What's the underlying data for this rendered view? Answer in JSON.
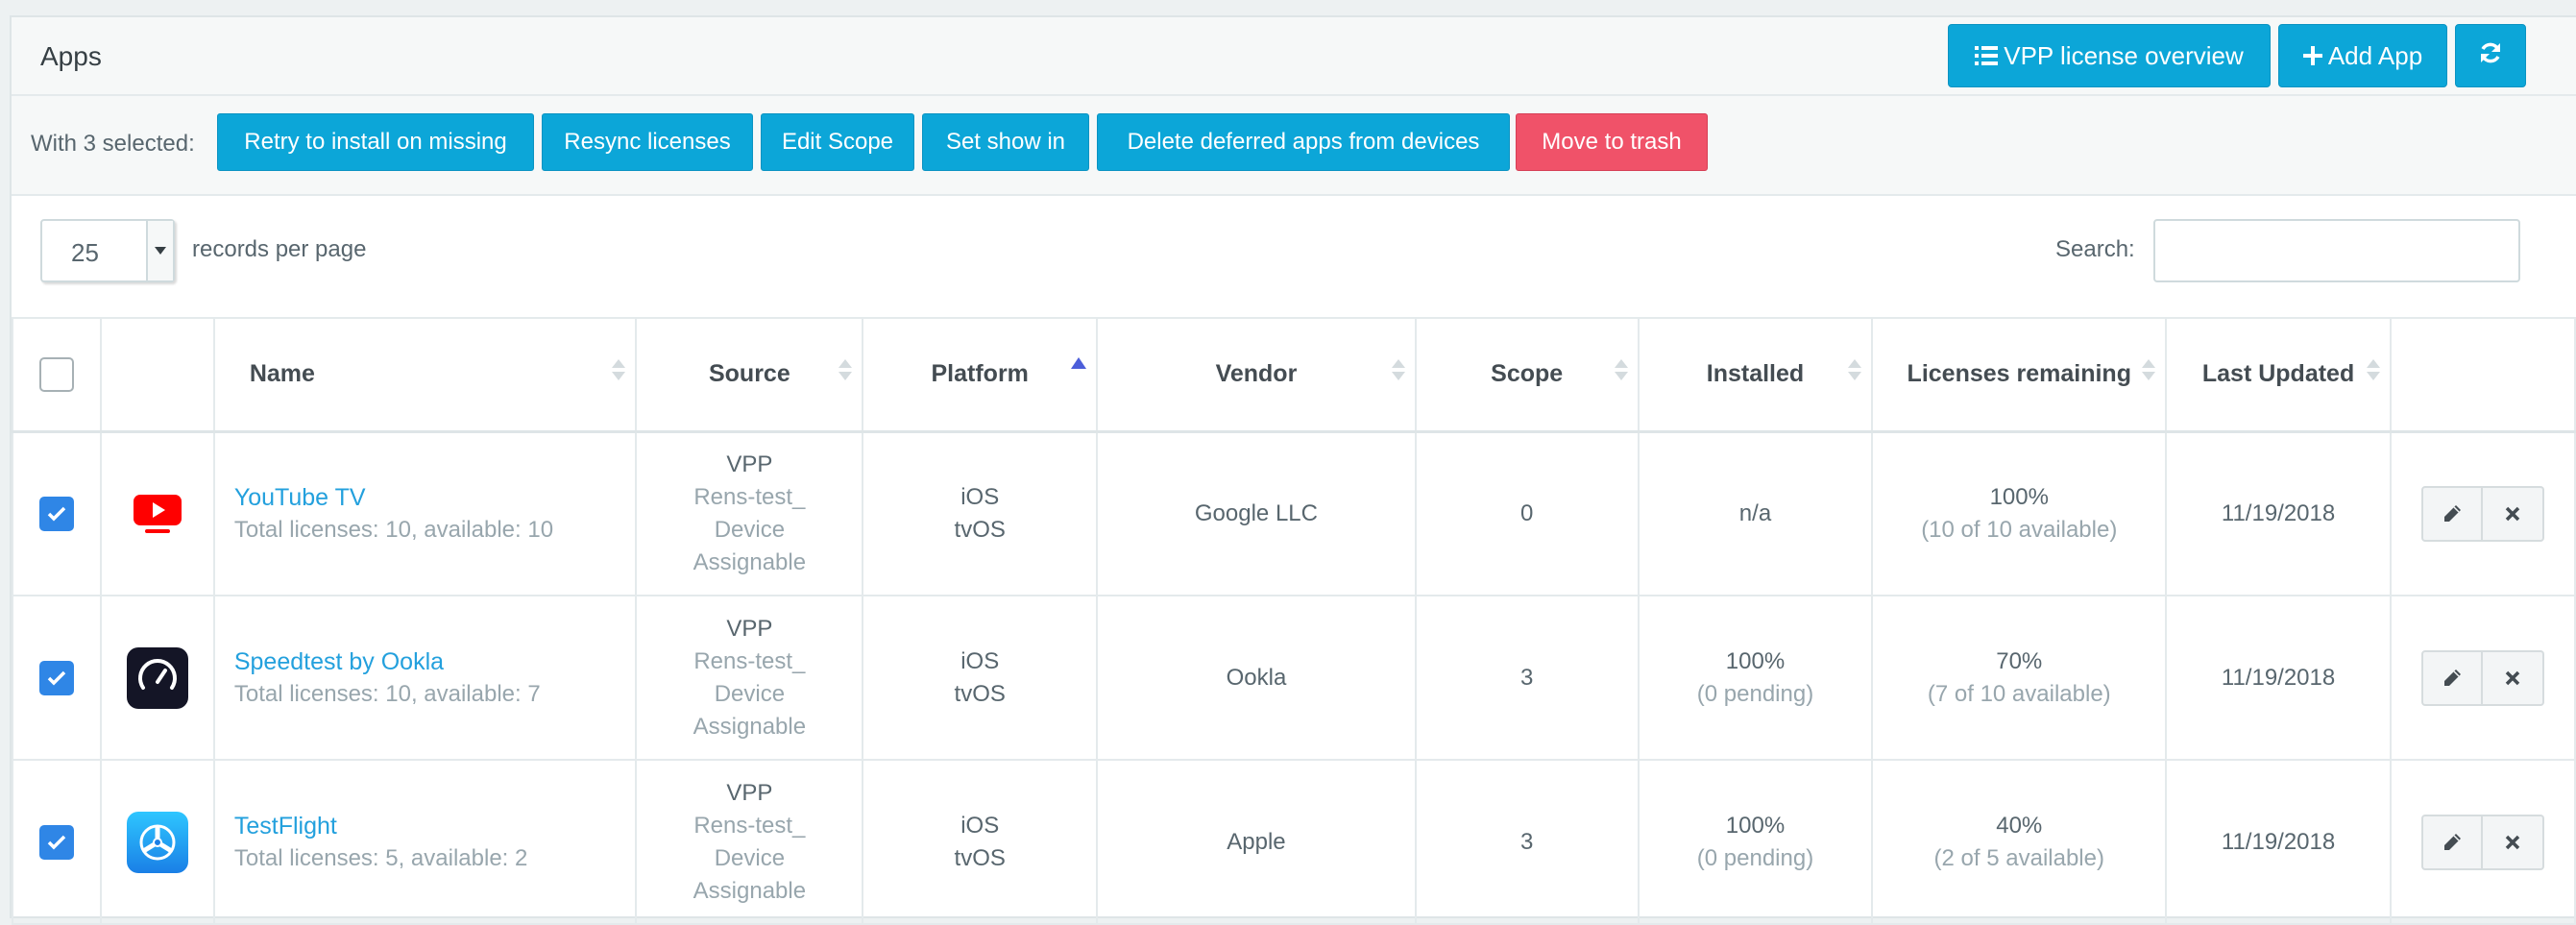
{
  "panel": {
    "title": "Apps"
  },
  "header_buttons": {
    "vpp_overview": "VPP license overview",
    "add_app": "Add App",
    "refresh_icon": "refresh-icon"
  },
  "bulk": {
    "label": "With 3 selected:",
    "retry": "Retry to install on missing",
    "resync": "Resync licenses",
    "edit_scope": "Edit Scope",
    "set_show_in": "Set show in",
    "delete_deferred": "Delete deferred apps from devices",
    "trash": "Move to trash"
  },
  "table_controls": {
    "page_length": "25",
    "records_label": "records per page",
    "search_label": "Search:",
    "search_value": ""
  },
  "columns": {
    "name": "Name",
    "source": "Source",
    "platform": "Platform",
    "vendor": "Vendor",
    "scope": "Scope",
    "installed": "Installed",
    "licenses_remaining": "Licenses remaining",
    "last_updated": "Last Updated"
  },
  "rows": [
    {
      "selected": true,
      "icon": "youtube-tv-icon",
      "name": "YouTube TV",
      "licenses": "Total licenses: 10, available: 10",
      "source_line1": "VPP",
      "source_line2": "Rens-test_",
      "source_line3": "Device",
      "source_line4": "Assignable",
      "platform_line1": "iOS",
      "platform_line2": "tvOS",
      "vendor": "Google LLC",
      "scope": "0",
      "installed_main": "n/a",
      "installed_sub": "",
      "remaining_main": "100%",
      "remaining_sub": "(10 of 10 available)",
      "last_updated": "11/19/2018"
    },
    {
      "selected": true,
      "icon": "speedtest-icon",
      "name": "Speedtest by Ookla",
      "licenses": "Total licenses: 10, available: 7",
      "source_line1": "VPP",
      "source_line2": "Rens-test_",
      "source_line3": "Device",
      "source_line4": "Assignable",
      "platform_line1": "iOS",
      "platform_line2": "tvOS",
      "vendor": "Ookla",
      "scope": "3",
      "installed_main": "100%",
      "installed_sub": "(0 pending)",
      "remaining_main": "70%",
      "remaining_sub": "(7 of 10 available)",
      "last_updated": "11/19/2018"
    },
    {
      "selected": true,
      "icon": "testflight-icon",
      "name": "TestFlight",
      "licenses": "Total licenses: 5, available: 2",
      "source_line1": "VPP",
      "source_line2": "Rens-test_",
      "source_line3": "Device",
      "source_line4": "Assignable",
      "platform_line1": "iOS",
      "platform_line2": "tvOS",
      "vendor": "Apple",
      "scope": "3",
      "installed_main": "100%",
      "installed_sub": "(0 pending)",
      "remaining_main": "40%",
      "remaining_sub": "(2 of 5 available)",
      "last_updated": "11/19/2018"
    }
  ],
  "colors": {
    "primary": "#0ca6d8",
    "danger": "#f05269",
    "link": "#23a0dd",
    "checkbox": "#2f86e6"
  }
}
